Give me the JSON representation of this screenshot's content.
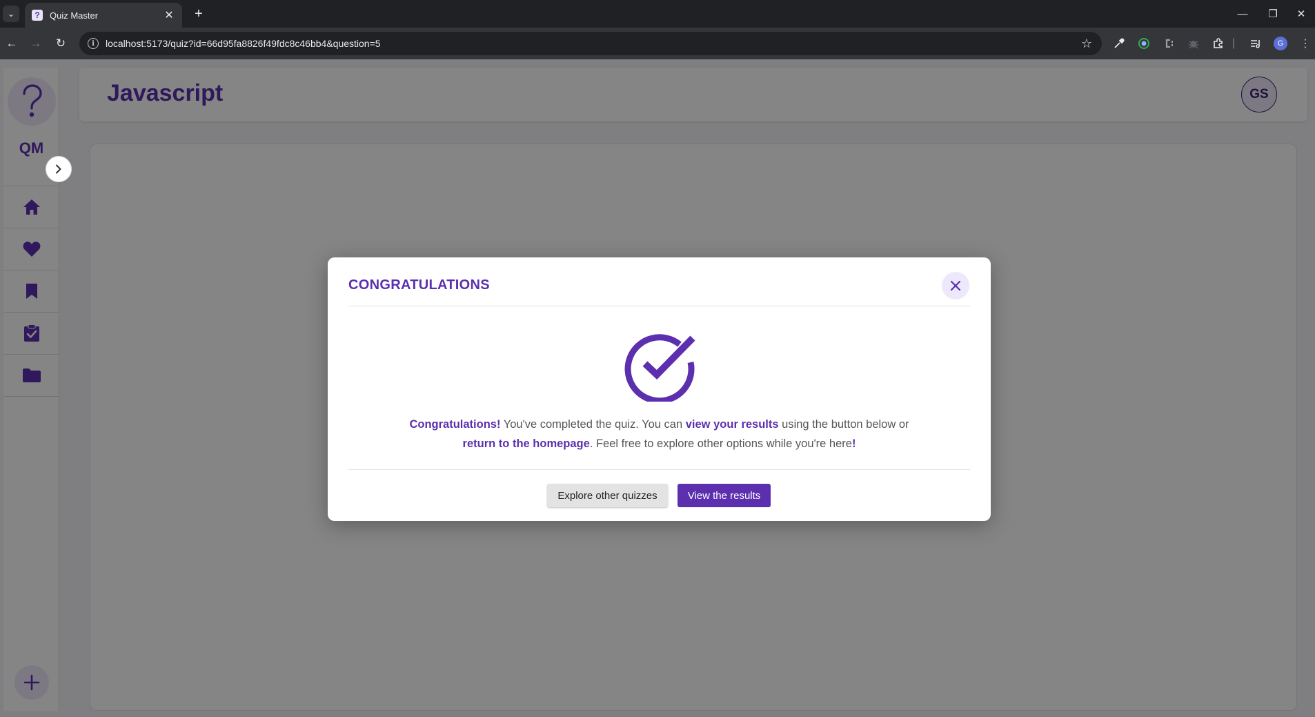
{
  "browser": {
    "tab_title": "Quiz Master",
    "tab_favicon": "?",
    "tab_close": "✕",
    "new_tab": "+",
    "url": "localhost:5173/quiz?id=66d95fa8826f49fdc8c46bb4&question=5",
    "profile_initial": "G"
  },
  "sidebar": {
    "logo_text": "QM",
    "items": [
      {
        "icon": "home-icon"
      },
      {
        "icon": "heart-icon"
      },
      {
        "icon": "bookmark-icon"
      },
      {
        "icon": "clipboard-check-icon"
      },
      {
        "icon": "folder-icon"
      }
    ]
  },
  "header": {
    "title": "Javascript",
    "avatar_initials": "GS"
  },
  "modal": {
    "title": "CONGRATULATIONS",
    "message": {
      "part1_bold": "Congratulations!",
      "part2": " You've completed the quiz. You can ",
      "part3_bold": "view your results",
      "part4": " using the button below or ",
      "part5_bold": "return to the homepage",
      "part6": ". Feel free to explore other options while you're here",
      "part7_bold": "!"
    },
    "secondary_button": "Explore other quizzes",
    "primary_button": "View the results"
  },
  "colors": {
    "brand": "#5b2fae",
    "brand_light": "#ede8fb"
  }
}
